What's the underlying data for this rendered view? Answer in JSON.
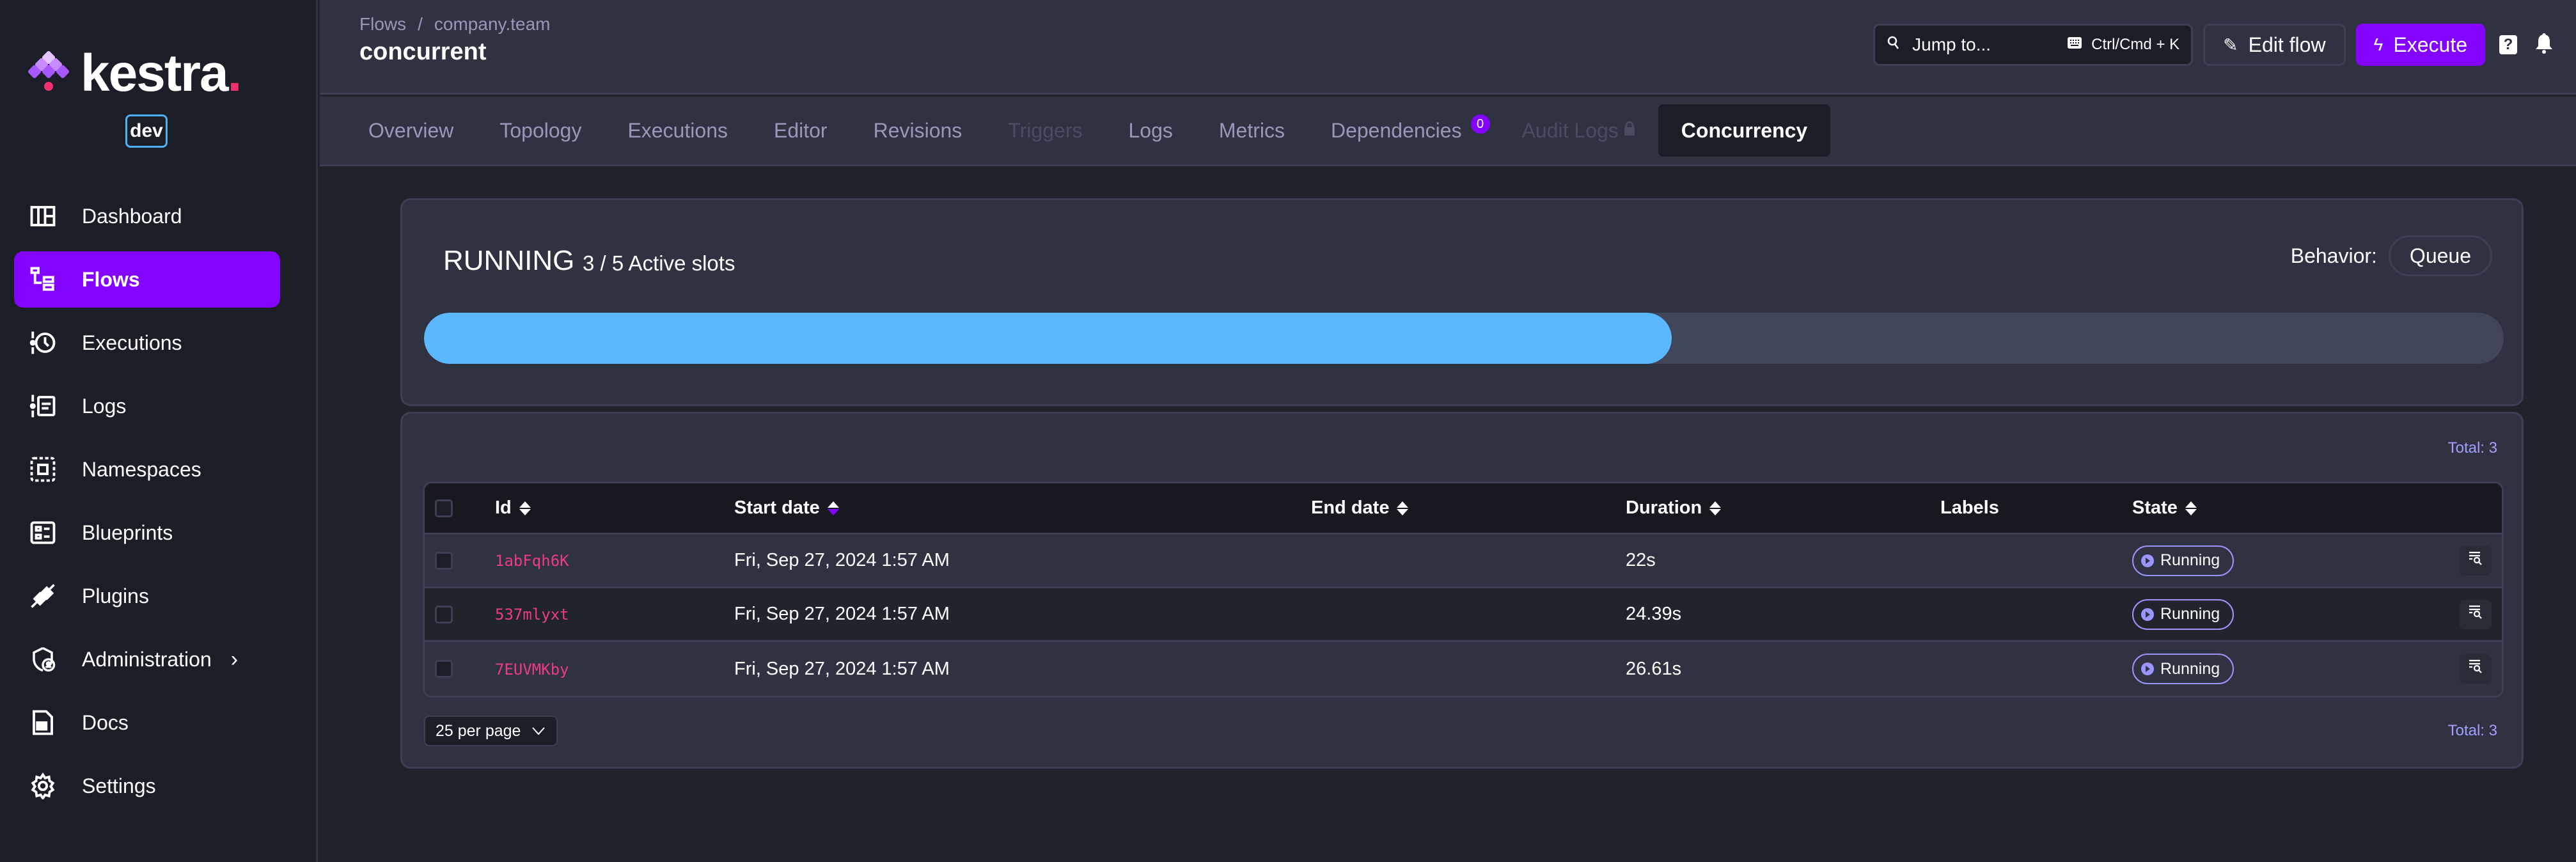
{
  "brand": {
    "name": "kestra",
    "env_badge": "dev",
    "accent": "#8405ff"
  },
  "sidebar": {
    "items": [
      {
        "label": "Dashboard",
        "icon": "dashboard-icon",
        "active": false
      },
      {
        "label": "Flows",
        "icon": "flows-icon",
        "active": true
      },
      {
        "label": "Executions",
        "icon": "executions-icon",
        "active": false
      },
      {
        "label": "Logs",
        "icon": "logs-icon",
        "active": false
      },
      {
        "label": "Namespaces",
        "icon": "namespaces-icon",
        "active": false
      },
      {
        "label": "Blueprints",
        "icon": "blueprints-icon",
        "active": false
      },
      {
        "label": "Plugins",
        "icon": "plugins-icon",
        "active": false
      },
      {
        "label": "Administration",
        "icon": "administration-icon",
        "active": false,
        "has_submenu": true
      },
      {
        "label": "Docs",
        "icon": "docs-icon",
        "active": false
      },
      {
        "label": "Settings",
        "icon": "settings-icon",
        "active": false
      }
    ]
  },
  "header": {
    "breadcrumb": [
      "Flows",
      "company.team"
    ],
    "breadcrumb_sep": "/",
    "title": "concurrent",
    "jump_to": {
      "placeholder": "Jump to...",
      "shortcut": "Ctrl/Cmd + K"
    },
    "edit_label": "Edit flow",
    "execute_label": "Execute",
    "help_label": "?"
  },
  "tabs": [
    {
      "label": "Overview",
      "state": "normal"
    },
    {
      "label": "Topology",
      "state": "normal"
    },
    {
      "label": "Executions",
      "state": "normal"
    },
    {
      "label": "Editor",
      "state": "normal"
    },
    {
      "label": "Revisions",
      "state": "normal"
    },
    {
      "label": "Triggers",
      "state": "disabled"
    },
    {
      "label": "Logs",
      "state": "normal"
    },
    {
      "label": "Metrics",
      "state": "normal"
    },
    {
      "label": "Dependencies",
      "state": "normal",
      "count": "0"
    },
    {
      "label": "Audit Logs",
      "state": "disabled",
      "locked": true
    },
    {
      "label": "Concurrency",
      "state": "active"
    }
  ],
  "concurrency": {
    "status": "RUNNING",
    "slots_text": "3 / 5 Active slots",
    "active_slots": 3,
    "max_slots": 5,
    "progress_fraction": 0.6,
    "behavior_label": "Behavior:",
    "behavior_value": "Queue"
  },
  "executions": {
    "total_label": "Total: 3",
    "columns": [
      {
        "label": "Id",
        "sortable": true
      },
      {
        "label": "Start date",
        "sortable": true,
        "sorted": "desc"
      },
      {
        "label": "End date",
        "sortable": true
      },
      {
        "label": "Duration",
        "sortable": true
      },
      {
        "label": "Labels",
        "sortable": false
      },
      {
        "label": "State",
        "sortable": true
      }
    ],
    "rows": [
      {
        "id": "1abFqh6K",
        "start": "Fri, Sep 27, 2024 1:57 AM",
        "end": "",
        "duration": "22s",
        "labels": "",
        "state": "Running"
      },
      {
        "id": "537mlyxt",
        "start": "Fri, Sep 27, 2024 1:57 AM",
        "end": "",
        "duration": "24.39s",
        "labels": "",
        "state": "Running"
      },
      {
        "id": "7EUVMKby",
        "start": "Fri, Sep 27, 2024 1:57 AM",
        "end": "",
        "duration": "26.61s",
        "labels": "",
        "state": "Running"
      }
    ],
    "per_page": "25 per page"
  }
}
